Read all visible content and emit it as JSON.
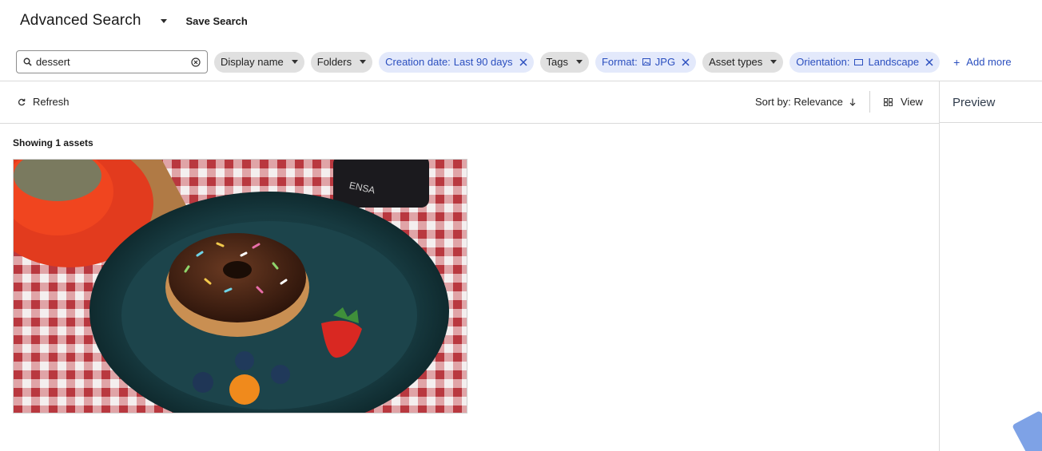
{
  "header": {
    "title": "Advanced Search",
    "save_search": "Save Search"
  },
  "search": {
    "value": "dessert",
    "placeholder": ""
  },
  "filters": [
    {
      "label": "Display name",
      "value": "",
      "active": false
    },
    {
      "label": "Folders",
      "value": "",
      "active": false
    },
    {
      "label": "Creation date:",
      "value": "Last 90 days",
      "active": true
    },
    {
      "label": "Tags",
      "value": "",
      "active": false
    },
    {
      "label": "Format:",
      "value": "JPG",
      "active": true,
      "icon": "image-icon"
    },
    {
      "label": "Asset types",
      "value": "",
      "active": false
    },
    {
      "label": "Orientation:",
      "value": "Landscape",
      "active": true,
      "icon": "landscape-rectangle-icon"
    }
  ],
  "add_more": "Add more",
  "toolbar": {
    "refresh": "Refresh",
    "sort": "Sort by: Relevance",
    "view": "View"
  },
  "preview": {
    "title": "Preview"
  },
  "results": {
    "showing": "Showing 1 assets",
    "assets": [
      {
        "alt": "Chocolate glazed donut with sprinkles on a dark teal plate with a strawberry, blueberries and a physalis, red cup and gingham tablecloth"
      }
    ]
  },
  "colors": {
    "accent": "#2b4fbf",
    "chip_active_bg": "#e3e9fb",
    "chip_neutral_bg": "#e0e0e0",
    "divider": "#dadada"
  }
}
